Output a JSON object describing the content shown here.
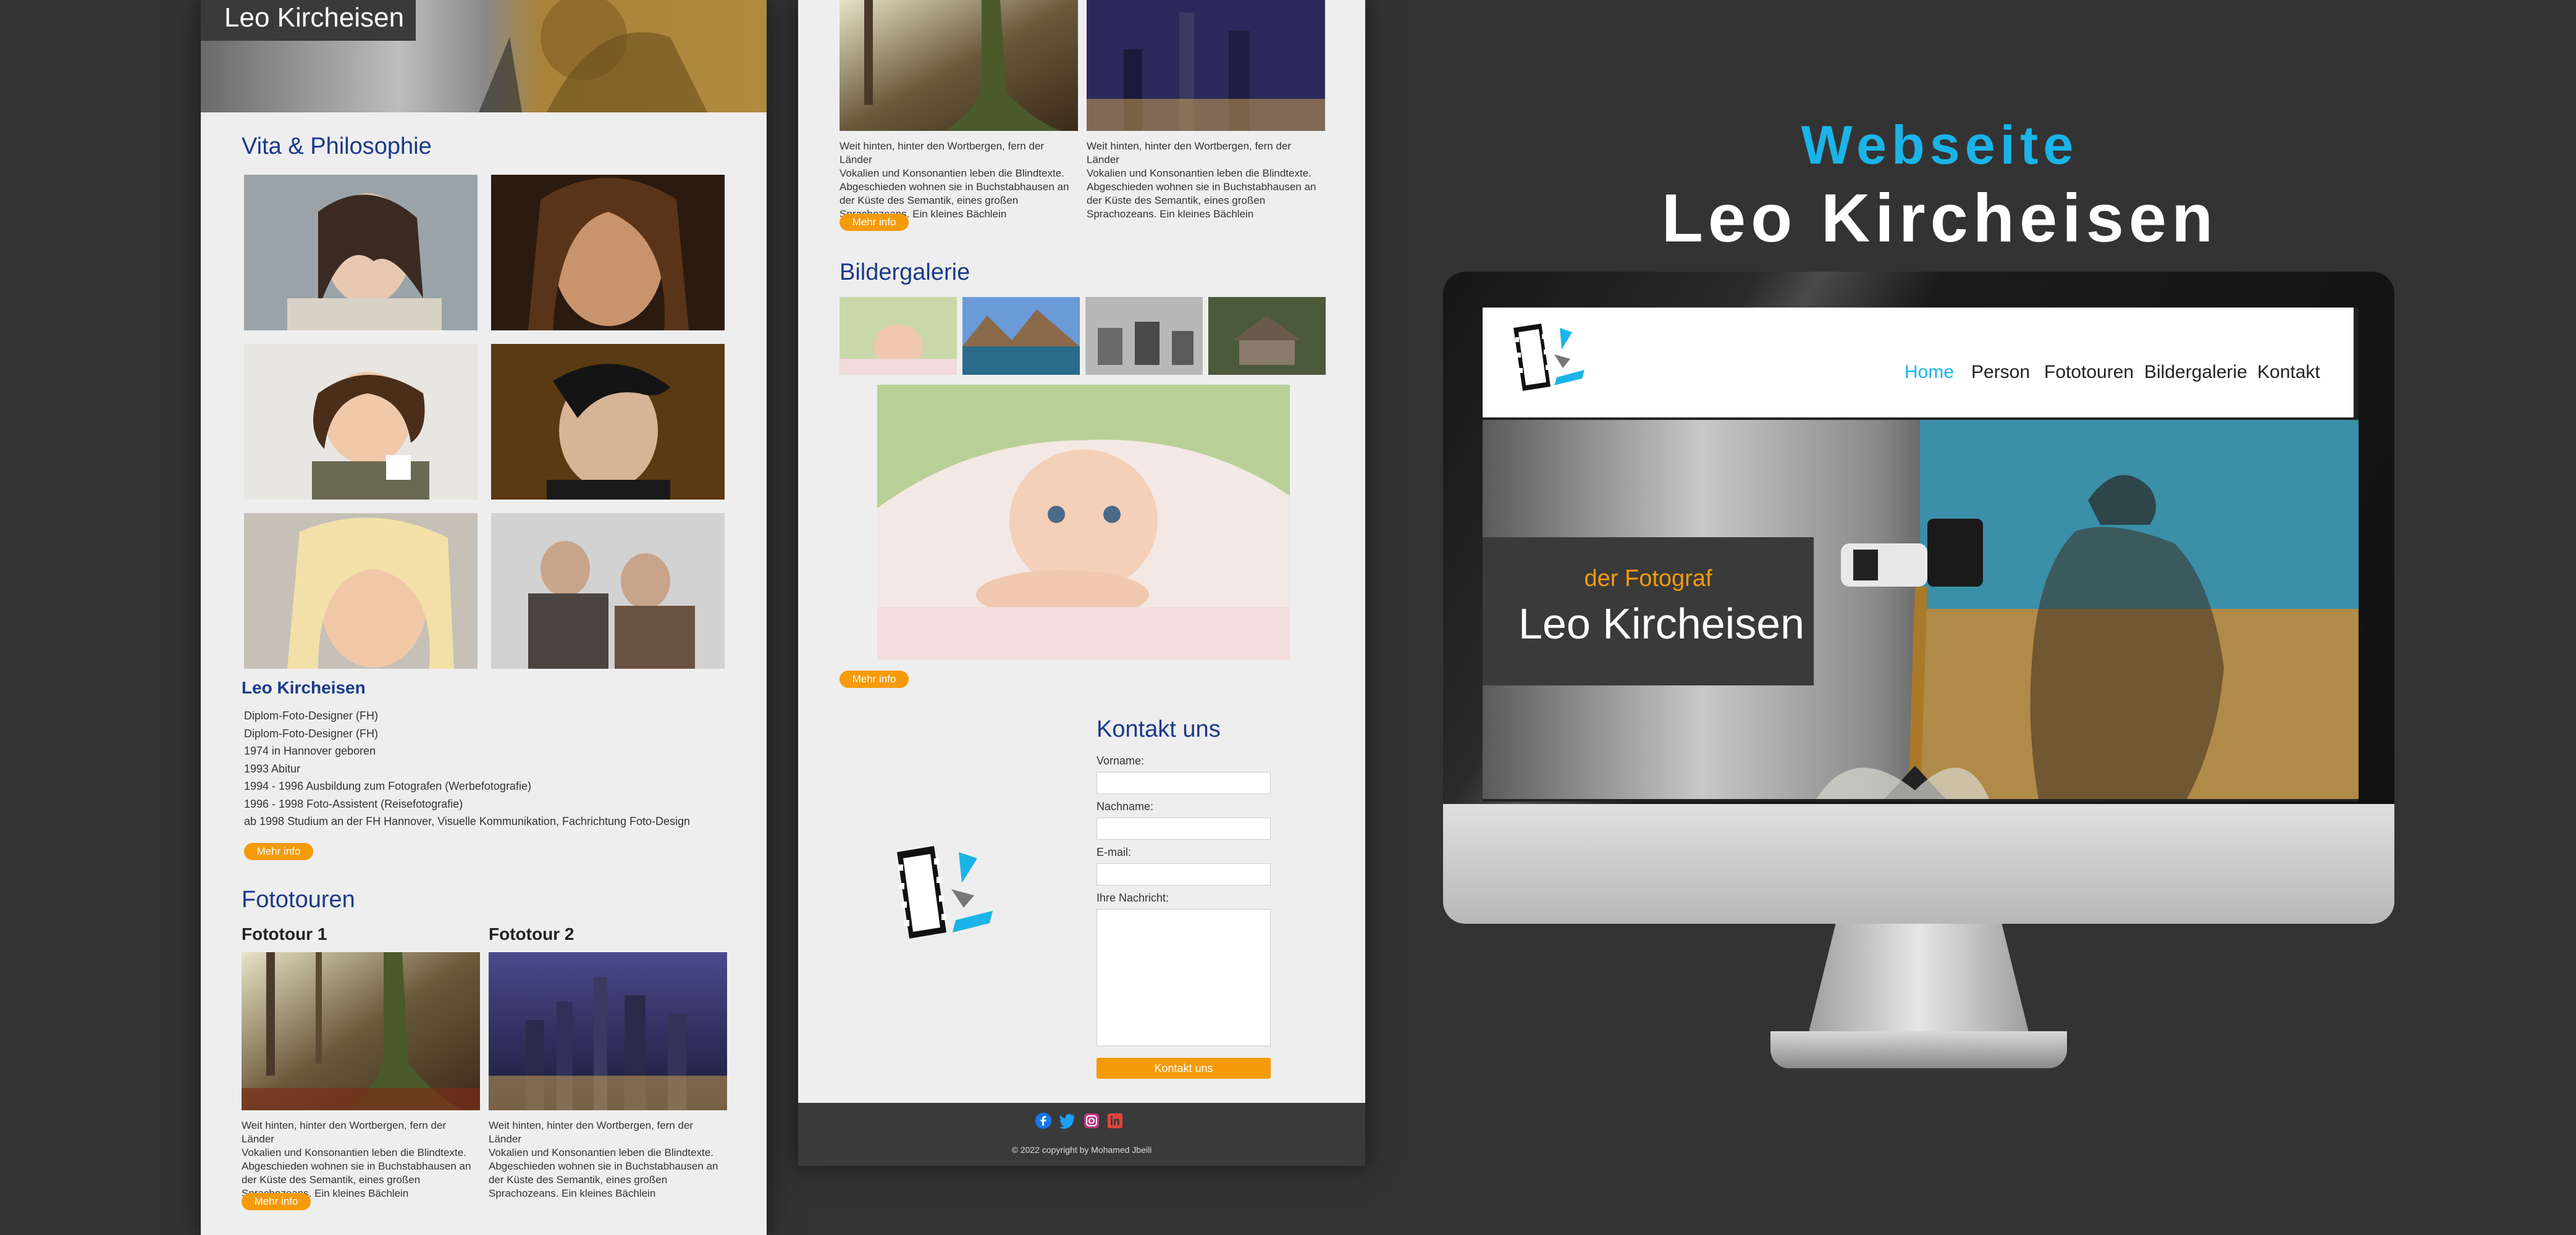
{
  "panel1": {
    "hero_name": "Leo Kircheisen",
    "vita": {
      "title": "Vita & Philosophie",
      "name": "Leo Kircheisen",
      "lines": [
        "Diplom-Foto-Designer (FH)",
        "Diplom-Foto-Designer (FH)",
        "1974 in Hannover geboren",
        "1993 Abitur",
        "1994 - 1996 Ausbildung zum Fotografen (Werbefotografie)",
        "1996 - 1998 Foto-Assistent (Reisefotografie)",
        "ab 1998 Studium an der FH Hannover, Visuelle Kommunikation, Fachrichtung Foto-Design"
      ],
      "more_label": "Mehr info"
    },
    "tours": {
      "title": "Fototouren",
      "items": [
        {
          "title": "Fototour 1",
          "text": [
            "Weit hinten, hinter den Wortbergen, fern der Länder",
            "Vokalien und Konsonantien leben die Blindtexte.",
            "Abgeschieden wohnen sie in Buchstabhausen an",
            "der Küste des Semantik, eines großen",
            "Sprachozeans. Ein kleines Bächlein"
          ]
        },
        {
          "title": "Fototour 2",
          "text": [
            "Weit hinten, hinter den Wortbergen, fern der Länder",
            "Vokalien und Konsonantien leben die Blindtexte.",
            "Abgeschieden wohnen sie in Buchstabhausen an",
            "der Küste des Semantik, eines großen",
            "Sprachozeans. Ein kleines Bächlein"
          ]
        }
      ],
      "more_label": "Mehr info"
    }
  },
  "panel2": {
    "tours": [
      {
        "text": [
          "Weit hinten, hinter den Wortbergen, fern der Länder",
          "Vokalien und Konsonantien leben die Blindtexte.",
          "Abgeschieden wohnen sie in Buchstabhausen an",
          "der Küste des Semantik, eines großen",
          "Sprachozeans. Ein kleines Bächlein"
        ]
      },
      {
        "text": [
          "Weit hinten, hinter den Wortbergen, fern der Länder",
          "Vokalien und Konsonantien leben die Blindtexte.",
          "Abgeschieden wohnen sie in Buchstabhausen an",
          "der Küste des Semantik, eines großen",
          "Sprachozeans. Ein kleines Bächlein"
        ]
      }
    ],
    "tours_more_label": "Mehr info",
    "gallery": {
      "title": "Bildergalerie",
      "more_label": "Mehr info"
    },
    "contact": {
      "title": "Kontakt uns",
      "firstname_label": "Vorname:",
      "lastname_label": "Nachname:",
      "email_label": "E-mail:",
      "message_label": "Ihre Nachricht:",
      "firstname_value": "",
      "lastname_value": "",
      "email_value": "",
      "message_value": "",
      "submit_label": "Kontakt uns"
    },
    "footer": {
      "copyright": "© 2022 copyright by Mohamed Jbeili",
      "social_icons": [
        "facebook-icon",
        "twitter-icon",
        "instagram-icon",
        "linkedin-icon"
      ]
    }
  },
  "mockup": {
    "heading_line1": "Webseite",
    "heading_line2": "Leo Kircheisen",
    "nav": {
      "items": [
        "Home",
        "Person",
        "Fototouren",
        "Bildergalerie",
        "Kontakt"
      ],
      "active": "Home"
    },
    "hero_subtitle": "der Fotograf",
    "hero_title": "Leo Kircheisen"
  },
  "colors": {
    "background": "#333333",
    "panel": "#eeeeee",
    "heading_blue": "#1a3a8a",
    "accent_cyan": "#1ab4e8",
    "button_orange": "#f59b0a",
    "footer": "#3a3a3a"
  }
}
